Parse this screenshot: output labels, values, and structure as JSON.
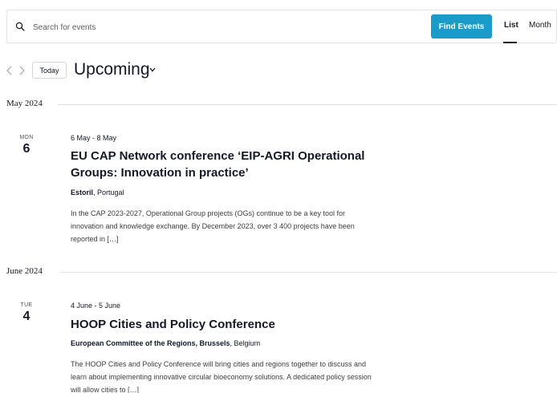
{
  "search": {
    "placeholder": "Search for events",
    "button_label": "Find Events"
  },
  "views": {
    "list_label": "List",
    "month_label": "Month",
    "active": "List"
  },
  "nav": {
    "today_label": "Today",
    "title": "Upcoming"
  },
  "colors": {
    "accent": "#1a9bc9",
    "text": "#141827"
  },
  "icons": {
    "search": "search-icon",
    "prev": "chevron-left-icon",
    "next": "chevron-right-icon",
    "title_dropdown": "chevron-down-icon"
  },
  "months": [
    {
      "label": "May 2024",
      "events": [
        {
          "weekday": "MON",
          "day": "6",
          "range": "6 May - 8 May",
          "title": "EU CAP Network conference ‘EIP-AGRI Operational Groups: Innovation in practice’",
          "venue_name": "Estoril",
          "venue_rest": ", Portugal",
          "description": "In the CAP 2023-2027, Operational Group projects (OGs) continue to be a key tool for innovation and knowledge exchange. By December 2023, over 3 400 projects have been reported in […]"
        }
      ]
    },
    {
      "label": "June 2024",
      "events": [
        {
          "weekday": "TUE",
          "day": "4",
          "range": "4 June - 5 June",
          "title": "HOOP Cities and Policy Conference",
          "venue_name": "European Committee of the Regions, Brussels",
          "venue_rest": ", Belgium",
          "description": "The HOOP Cities and Policy Conference will bring cities and regions together to discuss and learn about implementing innovative circular bioeconomy solutions. A dedicated policy session will allow cities to […]"
        }
      ]
    }
  ]
}
